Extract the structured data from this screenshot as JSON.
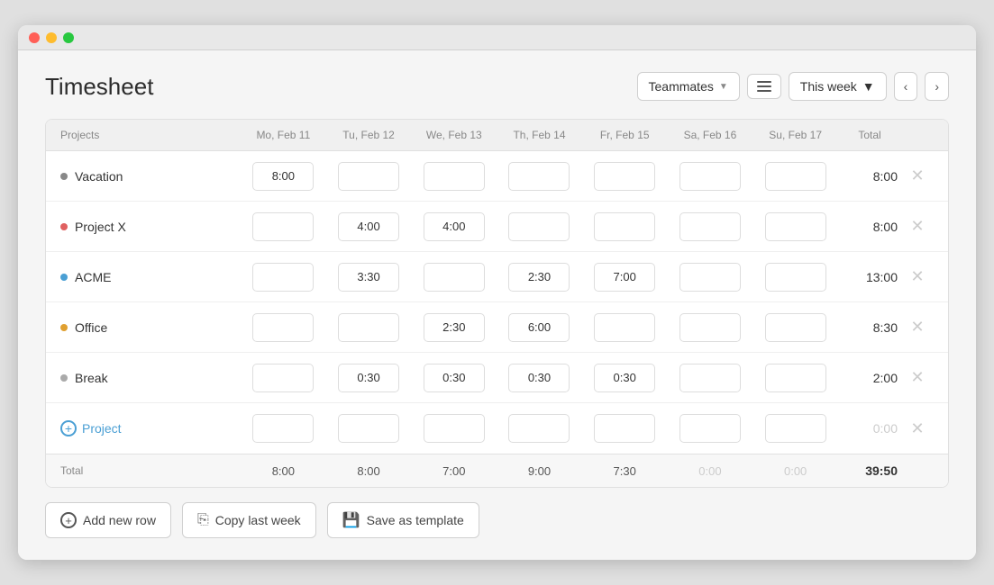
{
  "window": {
    "title": "Timesheet"
  },
  "header": {
    "title": "Timesheet",
    "teammates_label": "Teammates",
    "this_week_label": "This week"
  },
  "table": {
    "columns": {
      "projects": "Projects",
      "days": [
        "Mo, Feb 11",
        "Tu, Feb 12",
        "We, Feb 13",
        "Th, Feb 14",
        "Fr, Feb 15",
        "Sa, Feb 16",
        "Su, Feb 17"
      ],
      "total": "Total"
    },
    "rows": [
      {
        "name": "Vacation",
        "color": "#888888",
        "hours": [
          "8:00",
          "",
          "",
          "",
          "",
          "",
          ""
        ],
        "total": "8:00",
        "total_zero": false
      },
      {
        "name": "Project X",
        "color": "#e06060",
        "hours": [
          "",
          "4:00",
          "4:00",
          "",
          "",
          "",
          ""
        ],
        "total": "8:00",
        "total_zero": false
      },
      {
        "name": "ACME",
        "color": "#4a9fd4",
        "hours": [
          "",
          "3:30",
          "",
          "2:30",
          "7:00",
          "",
          ""
        ],
        "total": "13:00",
        "total_zero": false
      },
      {
        "name": "Office",
        "color": "#e0a030",
        "hours": [
          "",
          "",
          "2:30",
          "6:00",
          "",
          "",
          ""
        ],
        "total": "8:30",
        "total_zero": false
      },
      {
        "name": "Break",
        "color": "#888888",
        "hours": [
          "",
          "0:30",
          "0:30",
          "0:30",
          "0:30",
          "",
          ""
        ],
        "total": "2:00",
        "total_zero": false
      },
      {
        "name": "Project",
        "color": "#4a9fd4",
        "is_add": true,
        "hours": [
          "",
          "",
          "",
          "",
          "",
          "",
          ""
        ],
        "total": "0:00",
        "total_zero": true
      }
    ],
    "totals": {
      "label": "Total",
      "values": [
        "8:00",
        "8:00",
        "7:00",
        "9:00",
        "7:30",
        "0:00",
        "0:00"
      ],
      "grand": "39:50",
      "zero_indices": [
        5,
        6
      ]
    }
  },
  "footer": {
    "add_row_label": "Add new row",
    "copy_last_week_label": "Copy last week",
    "save_as_template_label": "Save as template"
  }
}
